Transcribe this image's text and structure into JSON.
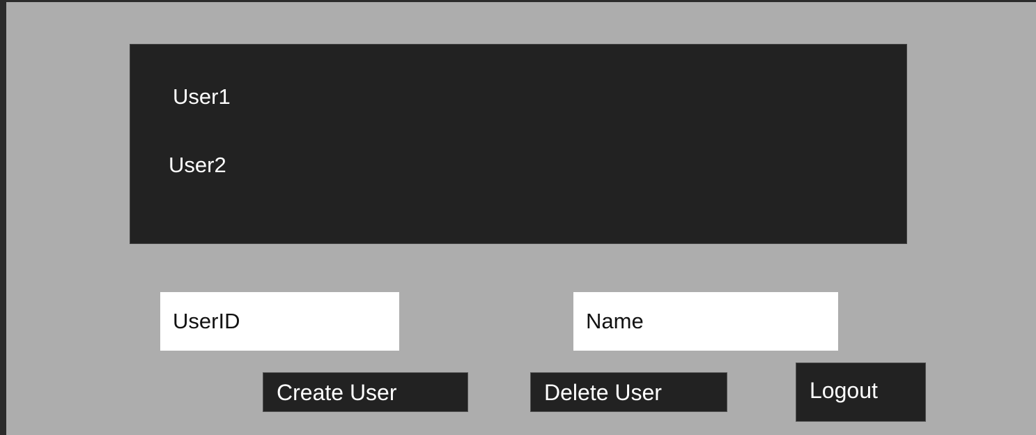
{
  "users": {
    "items": [
      {
        "label": "User1"
      },
      {
        "label": "User2"
      }
    ]
  },
  "form": {
    "userid_placeholder": "UserID",
    "name_placeholder": "Name"
  },
  "actions": {
    "create_label": "Create User",
    "delete_label": "Delete User",
    "logout_label": "Logout"
  },
  "colors": {
    "page_bg": "#adadad",
    "panel_bg": "#222222",
    "text_light": "#ffffff",
    "field_bg": "#ffffff"
  }
}
